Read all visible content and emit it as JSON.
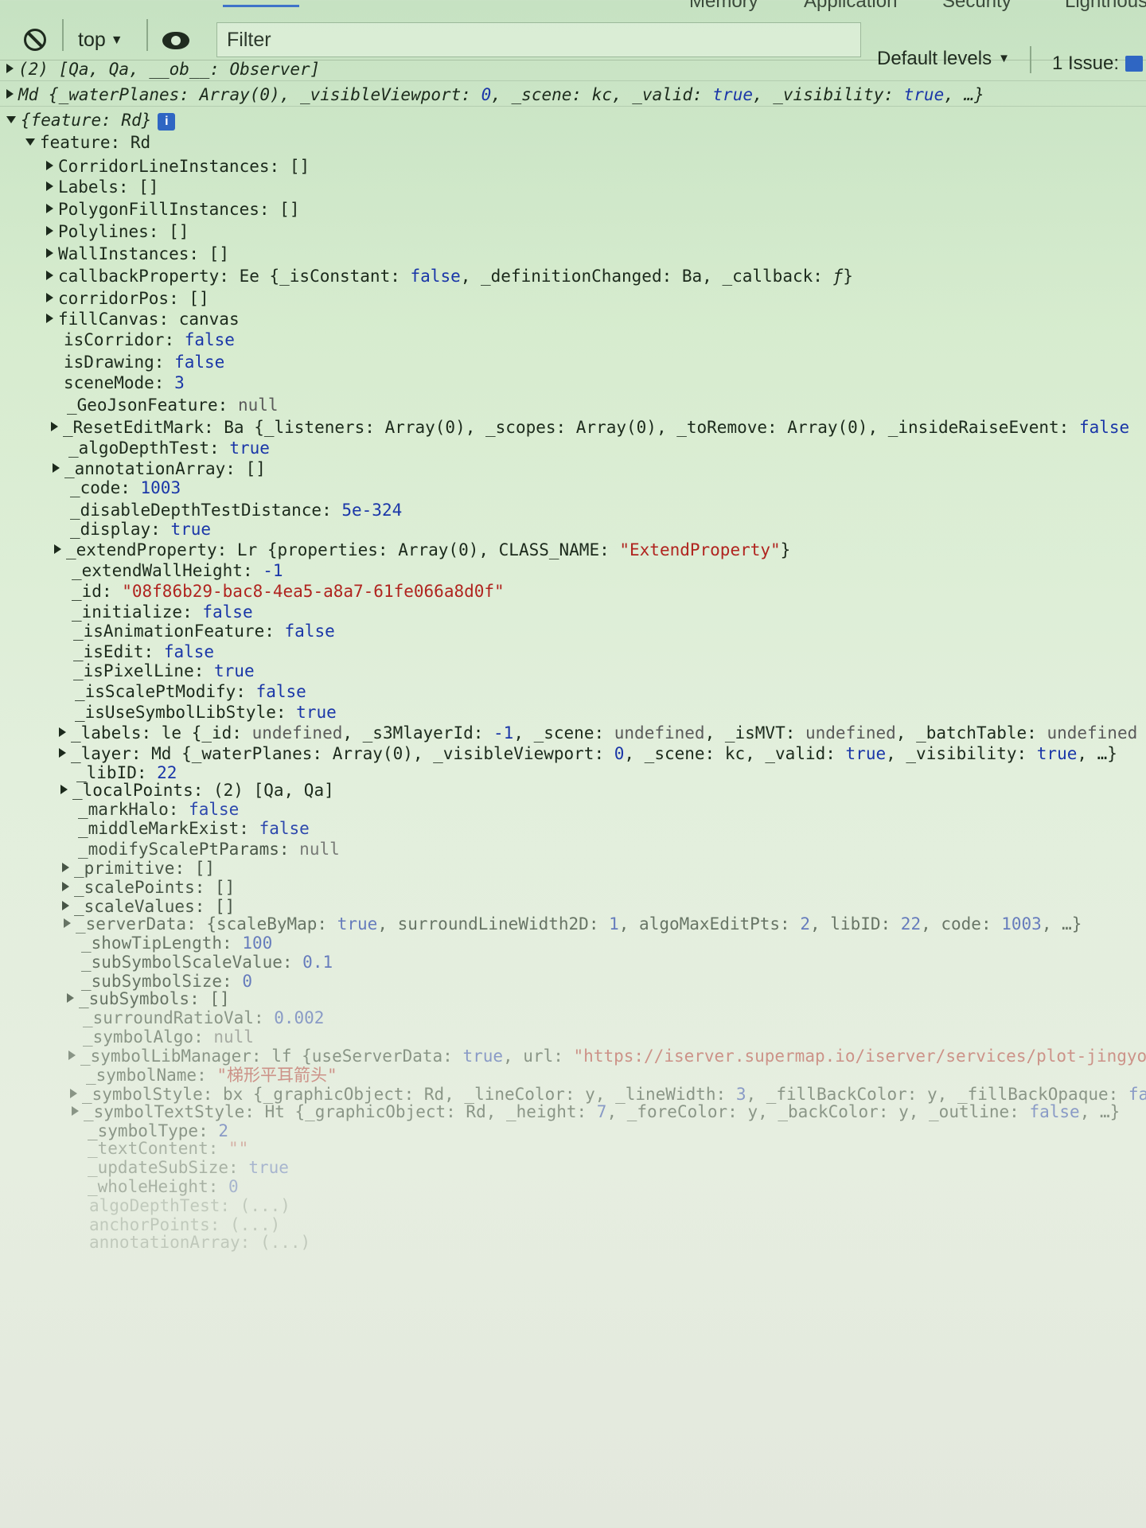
{
  "tabs": [
    "Memory",
    "Application",
    "Security",
    "Lighthouse"
  ],
  "toolbar": {
    "context": "top",
    "filter_placeholder": "Filter",
    "levels": "Default levels",
    "issues": "1 Issue:"
  },
  "rows": [
    {
      "type": "rich",
      "indent": 8,
      "toggle": "closed",
      "divider": true,
      "parts": [
        {
          "t": "(2) [Qa, Qa, __ob__: Observer]",
          "c": "it"
        }
      ]
    },
    {
      "type": "rich",
      "indent": 8,
      "toggle": "closed",
      "divider": true,
      "parts": [
        {
          "t": "Md {_waterPlanes: Array(0), _visibleViewport: ",
          "c": "it"
        },
        {
          "t": "0",
          "c": "it v-num"
        },
        {
          "t": ", _scene: kc, _valid: ",
          "c": "it"
        },
        {
          "t": "true",
          "c": "it v-bool"
        },
        {
          "t": ", _visibility: ",
          "c": "it"
        },
        {
          "t": "true",
          "c": "it v-bool"
        },
        {
          "t": ", …}",
          "c": "it"
        }
      ]
    },
    {
      "type": "rich",
      "indent": 8,
      "toggle": "open",
      "info": true,
      "parts": [
        {
          "t": "{feature: Rd}",
          "c": "it"
        }
      ]
    },
    {
      "type": "prop",
      "indent": 32,
      "toggle": "open",
      "key": "feature",
      "value": "Rd",
      "vt": "plain"
    },
    {
      "type": "prop",
      "indent": 58,
      "toggle": "closed",
      "key": "CorridorLineInstances",
      "value": "[]",
      "vt": "plain"
    },
    {
      "type": "prop",
      "indent": 58,
      "toggle": "closed",
      "key": "Labels",
      "value": "[]",
      "vt": "plain"
    },
    {
      "type": "prop",
      "indent": 58,
      "toggle": "closed",
      "key": "PolygonFillInstances",
      "value": "[]",
      "vt": "plain"
    },
    {
      "type": "prop",
      "indent": 58,
      "toggle": "closed",
      "key": "Polylines",
      "value": "[]",
      "vt": "plain"
    },
    {
      "type": "prop",
      "indent": 58,
      "toggle": "closed",
      "key": "WallInstances",
      "value": "[]",
      "vt": "plain"
    },
    {
      "type": "rich",
      "indent": 58,
      "toggle": "closed",
      "parts": [
        {
          "t": "callbackProperty: Ee {_isConstant: ",
          "c": ""
        },
        {
          "t": "false",
          "c": "v-bool"
        },
        {
          "t": ", _definitionChanged: Ba, _callback: ",
          "c": ""
        },
        {
          "t": "ƒ",
          "c": "it"
        },
        {
          "t": "}",
          "c": ""
        }
      ]
    },
    {
      "type": "prop",
      "indent": 58,
      "toggle": "closed",
      "key": "corridorPos",
      "value": "[]",
      "vt": "plain"
    },
    {
      "type": "prop",
      "indent": 58,
      "toggle": "closed",
      "key": "fillCanvas",
      "value": "canvas",
      "vt": "plain"
    },
    {
      "type": "prop",
      "indent": 80,
      "key": "isCorridor",
      "value": "false",
      "vt": "bool"
    },
    {
      "type": "prop",
      "indent": 80,
      "key": "isDrawing",
      "value": "false",
      "vt": "bool"
    },
    {
      "type": "prop",
      "indent": 80,
      "key": "sceneMode",
      "value": "3",
      "vt": "num"
    },
    {
      "type": "prop",
      "indent": 84,
      "key": "_GeoJsonFeature",
      "value": "null",
      "vt": "null"
    },
    {
      "type": "rich",
      "indent": 64,
      "toggle": "closed",
      "parts": [
        {
          "t": "_ResetEditMark: Ba {_listeners: Array(0), _scopes: Array(0), _toRemove: Array(0), _insideRaiseEvent: ",
          "c": ""
        },
        {
          "t": "false",
          "c": "v-bool"
        }
      ]
    },
    {
      "type": "prop",
      "indent": 86,
      "key": "_algoDepthTest",
      "value": "true",
      "vt": "bool"
    },
    {
      "type": "prop",
      "indent": 66,
      "toggle": "closed",
      "key": "_annotationArray",
      "value": "[]",
      "vt": "plain"
    },
    {
      "type": "prop",
      "indent": 88,
      "key": "_code",
      "value": "1003",
      "vt": "num"
    },
    {
      "type": "prop",
      "indent": 88,
      "key": "_disableDepthTestDistance",
      "value": "5e-324",
      "vt": "num"
    },
    {
      "type": "prop",
      "indent": 88,
      "key": "_display",
      "value": "true",
      "vt": "bool"
    },
    {
      "type": "rich",
      "indent": 68,
      "toggle": "closed",
      "parts": [
        {
          "t": "_extendProperty: Lr {properties: Array(0), CLASS_NAME: ",
          "c": ""
        },
        {
          "t": "\"ExtendProperty\"",
          "c": "v-str"
        },
        {
          "t": "}",
          "c": ""
        }
      ]
    },
    {
      "type": "prop",
      "indent": 90,
      "key": "_extendWallHeight",
      "value": "-1",
      "vt": "num"
    },
    {
      "type": "prop",
      "indent": 90,
      "key": "_id",
      "value": "\"08f86b29-bac8-4ea5-a8a7-61fe066a8d0f\"",
      "vt": "str"
    },
    {
      "type": "prop",
      "indent": 90,
      "key": "_initialize",
      "value": "false",
      "vt": "bool"
    },
    {
      "type": "prop",
      "indent": 92,
      "key": "_isAnimationFeature",
      "value": "false",
      "vt": "bool"
    },
    {
      "type": "prop",
      "indent": 92,
      "key": "_isEdit",
      "value": "false",
      "vt": "bool"
    },
    {
      "type": "prop",
      "indent": 92,
      "key": "_isPixelLine",
      "value": "true",
      "vt": "bool"
    },
    {
      "type": "prop",
      "indent": 94,
      "key": "_isScalePtModify",
      "value": "false",
      "vt": "bool"
    },
    {
      "type": "prop",
      "indent": 94,
      "key": "_isUseSymbolLibStyle",
      "value": "true",
      "vt": "bool"
    },
    {
      "type": "rich",
      "indent": 74,
      "toggle": "closed",
      "parts": [
        {
          "t": "_labels: le {_id: ",
          "c": ""
        },
        {
          "t": "undefined",
          "c": "v-null"
        },
        {
          "t": ", _s3MlayerId: ",
          "c": ""
        },
        {
          "t": "-1",
          "c": "v-num"
        },
        {
          "t": ", _scene: ",
          "c": ""
        },
        {
          "t": "undefined",
          "c": "v-null"
        },
        {
          "t": ", _isMVT: ",
          "c": ""
        },
        {
          "t": "undefined",
          "c": "v-null"
        },
        {
          "t": ", _batchTable: ",
          "c": ""
        },
        {
          "t": "undefined",
          "c": "v-null"
        }
      ]
    },
    {
      "type": "rich",
      "indent": 74,
      "toggle": "closed",
      "parts": [
        {
          "t": "_layer: Md {_waterPlanes: Array(0), _visibleViewport: ",
          "c": ""
        },
        {
          "t": "0",
          "c": "v-num"
        },
        {
          "t": ", _scene: kc, _valid: ",
          "c": ""
        },
        {
          "t": "true",
          "c": "v-bool"
        },
        {
          "t": ", _visibility: ",
          "c": ""
        },
        {
          "t": "true",
          "c": "v-bool"
        },
        {
          "t": ", …}",
          "c": ""
        }
      ]
    },
    {
      "type": "prop",
      "indent": 96,
      "key": "_libID",
      "value": "22",
      "vt": "num"
    },
    {
      "type": "prop",
      "indent": 76,
      "toggle": "closed",
      "key": "_localPoints",
      "value": "(2) [Qa, Qa]",
      "vt": "plain"
    },
    {
      "type": "prop",
      "indent": 98,
      "key": "_markHalo",
      "value": "false",
      "vt": "bool",
      "fade": 1
    },
    {
      "type": "prop",
      "indent": 98,
      "key": "_middleMarkExist",
      "value": "false",
      "vt": "bool",
      "fade": 1
    },
    {
      "type": "prop",
      "indent": 98,
      "key": "_modifyScalePtParams",
      "value": "null",
      "vt": "null",
      "fade": 2
    },
    {
      "type": "prop",
      "indent": 78,
      "toggle": "closed",
      "key": "_primitive",
      "value": "[]",
      "vt": "plain",
      "fade": 2
    },
    {
      "type": "prop",
      "indent": 78,
      "toggle": "closed",
      "key": "_scalePoints",
      "value": "[]",
      "vt": "plain",
      "fade": 2
    },
    {
      "type": "prop",
      "indent": 78,
      "toggle": "closed",
      "key": "_scaleValues",
      "value": "[]",
      "vt": "plain",
      "fade": 2
    },
    {
      "type": "rich",
      "indent": 80,
      "toggle": "closed",
      "fade": 3,
      "parts": [
        {
          "t": "_serverData: {scaleByMap: ",
          "c": ""
        },
        {
          "t": "true",
          "c": "v-bool"
        },
        {
          "t": ", surroundLineWidth2D: ",
          "c": ""
        },
        {
          "t": "1",
          "c": "v-num"
        },
        {
          "t": ", algoMaxEditPts: ",
          "c": ""
        },
        {
          "t": "2",
          "c": "v-num"
        },
        {
          "t": ", libID: ",
          "c": ""
        },
        {
          "t": "22",
          "c": "v-num"
        },
        {
          "t": ", code: ",
          "c": ""
        },
        {
          "t": "1003",
          "c": "v-num"
        },
        {
          "t": ", …}",
          "c": ""
        }
      ]
    },
    {
      "type": "prop",
      "indent": 102,
      "key": "_showTipLength",
      "value": "100",
      "vt": "num",
      "fade": 3
    },
    {
      "type": "prop",
      "indent": 102,
      "key": "_subSymbolScaleValue",
      "value": "0.1",
      "vt": "num",
      "fade": 3
    },
    {
      "type": "prop",
      "indent": 102,
      "key": "_subSymbolSize",
      "value": "0",
      "vt": "num",
      "fade": 3
    },
    {
      "type": "prop",
      "indent": 84,
      "toggle": "closed",
      "key": "_subSymbols",
      "value": "[]",
      "vt": "plain",
      "fade": 3
    },
    {
      "type": "prop",
      "indent": 104,
      "key": "_surroundRatioVal",
      "value": "0.002",
      "vt": "num",
      "fade": 4
    },
    {
      "type": "prop",
      "indent": 104,
      "key": "_symbolAlgo",
      "value": "null",
      "vt": "null",
      "fade": 4
    },
    {
      "type": "rich",
      "indent": 86,
      "toggle": "closed",
      "fade": 4,
      "parts": [
        {
          "t": "_symbolLibManager: lf {useServerData: ",
          "c": ""
        },
        {
          "t": "true",
          "c": "v-bool"
        },
        {
          "t": ", url: ",
          "c": ""
        },
        {
          "t": "\"https://iserver.supermap.io/iserver/services/plot-jingyong/",
          "c": "v-str"
        }
      ]
    },
    {
      "type": "prop",
      "indent": 108,
      "key": "_symbolName",
      "value": "\"梯形平耳箭头\"",
      "vt": "str",
      "fade": 4
    },
    {
      "type": "rich",
      "indent": 88,
      "toggle": "closed",
      "fade": 4,
      "parts": [
        {
          "t": "_symbolStyle: bx {_graphicObject: Rd, _lineColor: y, _lineWidth: ",
          "c": ""
        },
        {
          "t": "3",
          "c": "v-num"
        },
        {
          "t": ", _fillBackColor: y, _fillBackOpaque: ",
          "c": ""
        },
        {
          "t": "false",
          "c": "v-bool"
        },
        {
          "t": ",",
          "c": ""
        }
      ]
    },
    {
      "type": "rich",
      "indent": 90,
      "toggle": "closed",
      "fade": 4,
      "parts": [
        {
          "t": "_symbolTextStyle: Ht {_graphicObject: Rd, _height: ",
          "c": ""
        },
        {
          "t": "7",
          "c": "v-num"
        },
        {
          "t": ", _foreColor: y, _backColor: y, _outline: ",
          "c": ""
        },
        {
          "t": "false",
          "c": "v-bool"
        },
        {
          "t": ", …}",
          "c": ""
        }
      ]
    },
    {
      "type": "prop",
      "indent": 110,
      "key": "_symbolType",
      "value": "2",
      "vt": "num",
      "fade": 4
    },
    {
      "type": "prop",
      "indent": 110,
      "key": "_textContent",
      "value": "\"\"",
      "vt": "str",
      "fade": 5
    },
    {
      "type": "prop",
      "indent": 110,
      "key": "_updateSubSize",
      "value": "true",
      "vt": "bool",
      "fade": 5
    },
    {
      "type": "prop",
      "indent": 110,
      "key": "_wholeHeight",
      "value": "0",
      "vt": "num",
      "fade": 5
    },
    {
      "type": "prop",
      "indent": 112,
      "key": "algoDepthTest",
      "value": "(...)",
      "vt": "plain",
      "fade": 6
    },
    {
      "type": "prop",
      "indent": 112,
      "key": "anchorPoints",
      "value": "(...)",
      "vt": "plain",
      "fade": 6
    },
    {
      "type": "prop",
      "indent": 112,
      "key": "annotationArray",
      "value": "(...)",
      "vt": "plain",
      "fade": 6
    }
  ]
}
